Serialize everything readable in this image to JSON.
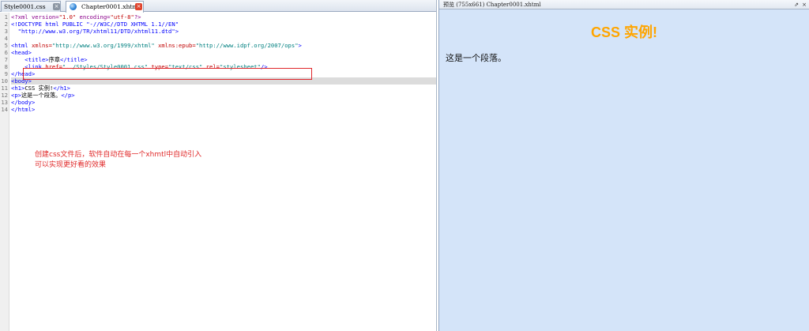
{
  "editor": {
    "tabs": [
      {
        "label": "Style0001.css",
        "active": false
      },
      {
        "label": "Chapter0001.xhtml",
        "active": true
      }
    ],
    "close_glyph": "×",
    "line_numbers": [
      "1",
      "2",
      "3",
      "4",
      "5",
      "6",
      "7",
      "8",
      "9",
      "10",
      "11",
      "12",
      "13",
      "14"
    ],
    "code": {
      "l1_a": "<?xml version=",
      "l1_b": "\"1.0\"",
      "l1_c": " encoding=",
      "l1_d": "\"utf-8\"",
      "l1_e": "?>",
      "l2": "<!DOCTYPE html PUBLIC \"-//W3C//DTD XHTML 1.1//EN\"",
      "l3": "  \"http://www.w3.org/TR/xhtml11/DTD/xhtml11.dtd\">",
      "l5_a": "<html ",
      "l5_b": "xmlns=",
      "l5_c": "\"http://www.w3.org/1999/xhtml\"",
      "l5_d": " xmlns:epub=",
      "l5_e": "\"http://www.idpf.org/2007/ops\"",
      "l5_f": ">",
      "l6": "<head>",
      "l7_a": "    <title>",
      "l7_b": "序章",
      "l7_c": "</title>",
      "l8_a": "    <link ",
      "l8_b": "href=",
      "l8_c": "\"../Styles/Style0001.css\"",
      "l8_d": " type=",
      "l8_e": "\"text/css\"",
      "l8_f": " rel=",
      "l8_g": "\"stylesheet\"",
      "l8_h": "/>",
      "l9": "</head>",
      "l10": "<body>",
      "l11_a": "<h1>",
      "l11_b": "CSS 实例!",
      "l11_c": "</h1>",
      "l12_a": "<p>",
      "l12_b": "这是一个段落。",
      "l12_c": "</p>",
      "l13": "</body>",
      "l14": "</html>"
    },
    "annotation": {
      "line1": "创建css文件后，软件自动在每一个xhmtl中自动引入",
      "line2": "可以实现更好看的效果"
    }
  },
  "preview": {
    "title": "预览 (755x661) Chapter0001.xhtml",
    "pin_icon": "⇗",
    "close_icon": "×",
    "heading": "CSS 实例!",
    "paragraph": "这是一个段落。",
    "heading_color": "#ffa500",
    "background": "#d4e4f9"
  }
}
